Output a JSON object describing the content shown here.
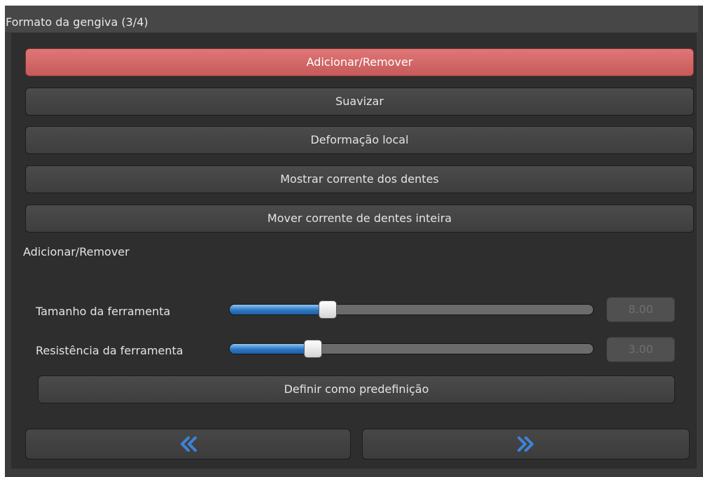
{
  "panel": {
    "title": "Formato da gengiva (3/4)"
  },
  "tools": [
    {
      "label": "Adicionar/Remover",
      "active": true
    },
    {
      "label": "Suavizar",
      "active": false
    },
    {
      "label": "Deformação local",
      "active": false
    },
    {
      "label": "Mostrar corrente dos dentes",
      "active": false
    },
    {
      "label": "Mover corrente de dentes inteira",
      "active": false
    }
  ],
  "section_label": "Adicionar/Remover",
  "sliders": [
    {
      "label": "Tamanho da ferramenta",
      "value_text": "8.00",
      "level": 0.27
    },
    {
      "label": "Resistência da ferramenta",
      "value_text": "3.00",
      "level": 0.23
    }
  ],
  "set_default_label": "Definir como predefinição",
  "nav": {
    "prev_icon": "double-chevron-left-icon",
    "next_icon": "double-chevron-right-icon"
  },
  "colors": {
    "active_button": "#d96a6a",
    "slider_fill": "#2c77c4",
    "nav_icon": "#3d83d6"
  }
}
